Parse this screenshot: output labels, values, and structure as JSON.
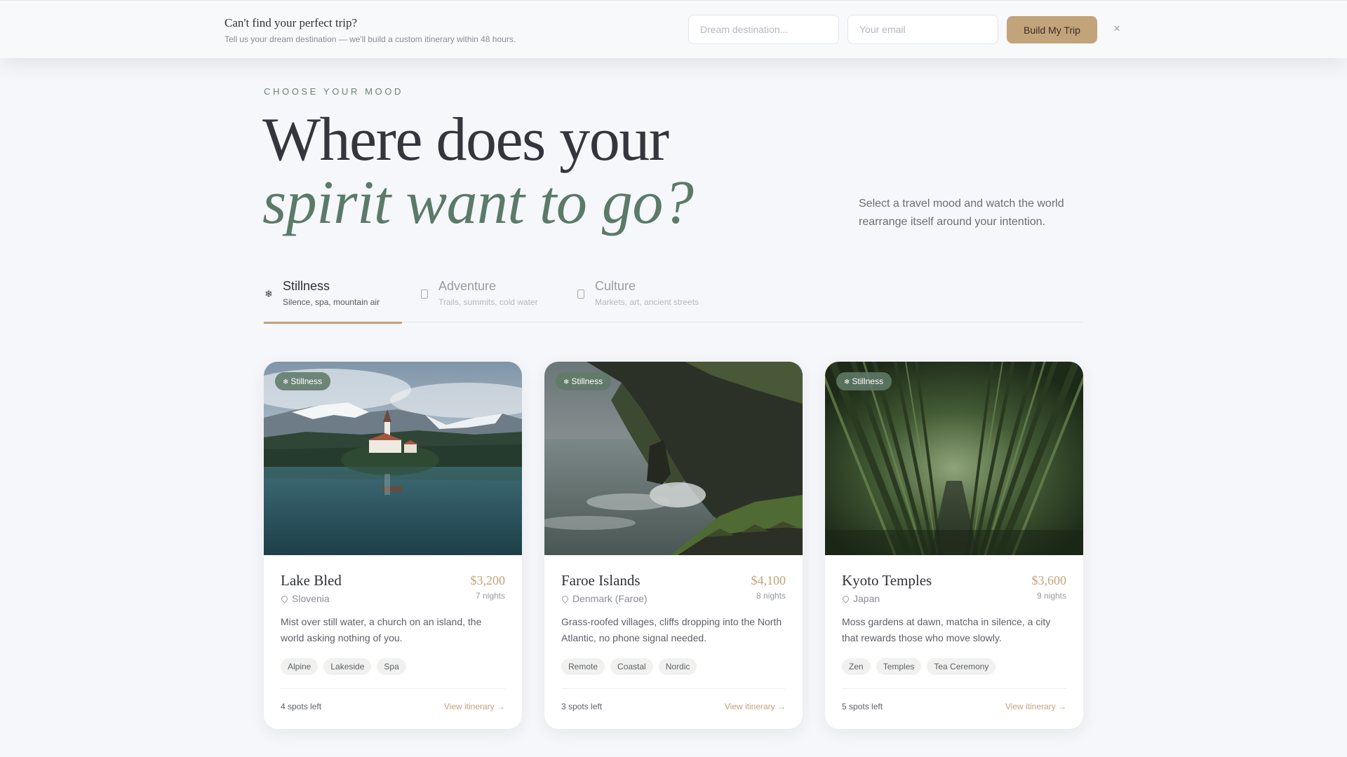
{
  "banner": {
    "title": "Can't find your perfect trip?",
    "subtitle": "Tell us your dream destination — we'll build a custom itinerary within 48 hours.",
    "destination_placeholder": "Dream destination...",
    "email_placeholder": "Your email",
    "build_label": "Build My Trip",
    "close_icon": "×"
  },
  "hero": {
    "eyebrow": "CHOOSE YOUR MOOD",
    "title_line1": "Where does your",
    "title_line2": "spirit want to go?",
    "description": "Select a travel mood and watch the world rearrange itself around your intention."
  },
  "tabs": [
    {
      "label": "Stillness",
      "subtitle": "Silence, spa, mountain air",
      "icon": "snowflake-icon",
      "glyph": "❄",
      "active": true
    },
    {
      "label": "Adventure",
      "subtitle": "Trails, summits, cold water",
      "icon": "square-icon",
      "active": false
    },
    {
      "label": "Culture",
      "subtitle": "Markets, art, ancient streets",
      "icon": "square-icon",
      "active": false
    }
  ],
  "cards": [
    {
      "badge": "Stillness",
      "badge_glyph": "❄",
      "image_icon": "lake-mountain-image",
      "name": "Lake Bled",
      "price": "$3,200",
      "nights": "7 nights",
      "location": "Slovenia",
      "description": "Mist over still water, a church on an island, the world asking nothing of you.",
      "tags": [
        "Alpine",
        "Lakeside",
        "Spa"
      ],
      "spots": "4 spots left",
      "link": "View itinerary →"
    },
    {
      "badge": "Stillness",
      "badge_glyph": "❄",
      "image_icon": "sea-cliffs-image",
      "name": "Faroe Islands",
      "price": "$4,100",
      "nights": "8 nights",
      "location": "Denmark (Faroe)",
      "description": "Grass-roofed villages, cliffs dropping into the North Atlantic, no phone signal needed.",
      "tags": [
        "Remote",
        "Coastal",
        "Nordic"
      ],
      "spots": "3 spots left",
      "link": "View itinerary →"
    },
    {
      "badge": "Stillness",
      "badge_glyph": "❄",
      "image_icon": "bamboo-forest-image",
      "name": "Kyoto Temples",
      "price": "$3,600",
      "nights": "9 nights",
      "location": "Japan",
      "description": "Moss gardens at dawn, matcha in silence, a city that rewards those who move slowly.",
      "tags": [
        "Zen",
        "Temples",
        "Tea Ceremony"
      ],
      "spots": "5 spots left",
      "link": "View itinerary →"
    }
  ],
  "colors": {
    "accent_gold": "#c3a37a",
    "accent_green": "#5b7a69",
    "badge_green": "#607a68",
    "background": "#f6f7fa"
  }
}
